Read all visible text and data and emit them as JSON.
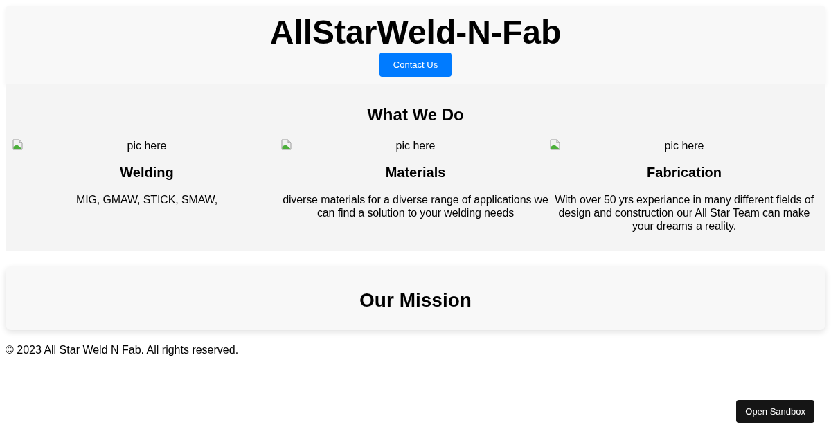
{
  "header": {
    "title": "AllStarWeld-N-Fab",
    "button": "Contact Us"
  },
  "services": {
    "heading": "What We Do",
    "items": [
      {
        "image_alt": "pic here",
        "title": "Welding",
        "description": "MIG, GMAW, STICK, SMAW,"
      },
      {
        "image_alt": "pic here",
        "title": "Materials",
        "description": "diverse materials for a diverse range of applications we can find a solution to your welding needs"
      },
      {
        "image_alt": "pic here",
        "title": "Fabrication",
        "description": "With over 50 yrs experiance in many different fields of design and construction our All Star Team can make your dreams a reality."
      }
    ]
  },
  "mission": {
    "heading": "Our Mission"
  },
  "footer": {
    "text": "© 2023 All Star Weld N Fab. All rights reserved."
  },
  "sandbox_button": "Open Sandbox"
}
